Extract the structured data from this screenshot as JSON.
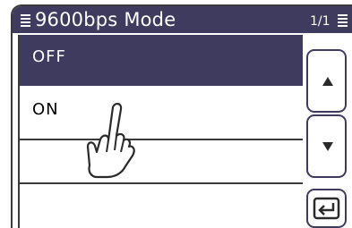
{
  "titlebar": {
    "title": "9600bps Mode",
    "page_indicator": "1/1",
    "left_icon": "menu-lines-icon",
    "right_icon": "menu-lines-icon"
  },
  "options": [
    {
      "label": "OFF",
      "selected": true
    },
    {
      "label": "ON",
      "selected": false
    },
    {
      "label": "",
      "selected": false
    },
    {
      "label": "",
      "selected": false
    }
  ],
  "controls": {
    "scroll_up_icon": "triangle-up-icon",
    "scroll_down_icon": "triangle-down-icon",
    "back_icon": "return-arrow-icon"
  },
  "overlay": {
    "pointer_icon": "touch-hand-icon"
  },
  "colors": {
    "titlebar_bg": "#3e3b5e",
    "selected_bg": "#3e3b5e",
    "text_light": "#ffffff",
    "text_dark": "#2a2a2a"
  }
}
